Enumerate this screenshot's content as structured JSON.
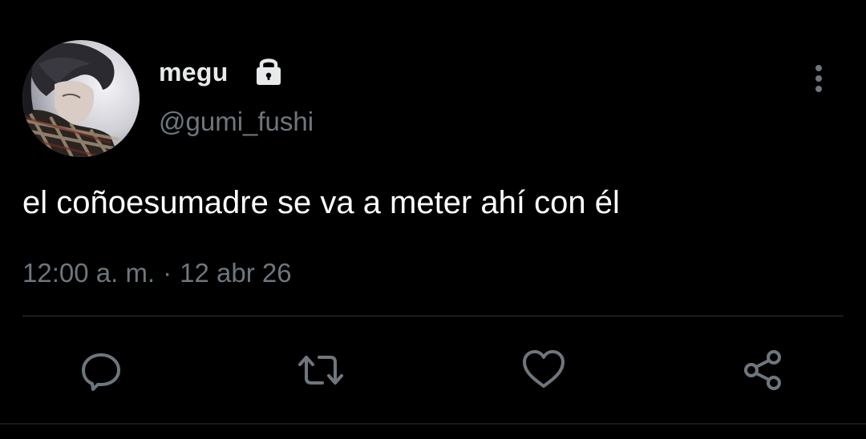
{
  "user": {
    "display_name": "megu",
    "handle": "@gumi_fushi",
    "protected_icon": "lock-icon",
    "avatar": "profile-photo"
  },
  "tweet": {
    "text": "el coñoesumadre se va a meter ahí con él",
    "time": "12:00 a. m.",
    "separator": "·",
    "date": "12 abr 26"
  },
  "actions": [
    {
      "name": "reply",
      "icon": "reply-icon"
    },
    {
      "name": "retweet",
      "icon": "retweet-icon"
    },
    {
      "name": "like",
      "icon": "heart-icon"
    },
    {
      "name": "share",
      "icon": "share-icon"
    }
  ],
  "menu": {
    "icon": "more-vertical-icon"
  },
  "colors": {
    "background": "#000000",
    "primary_text": "#ffffff",
    "secondary_text": "#6e767d",
    "divider": "#2f3336"
  }
}
